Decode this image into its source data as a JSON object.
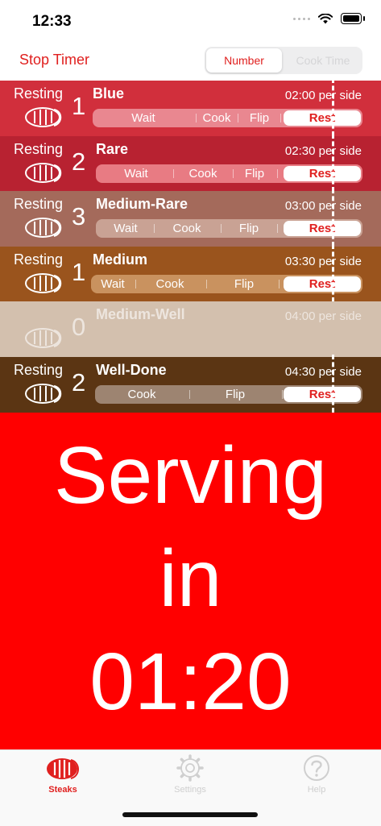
{
  "status_bar": {
    "time": "12:33"
  },
  "nav": {
    "stop_label": "Stop Timer",
    "segments": [
      "Number",
      "Cook Time"
    ],
    "selected_segment": "Number"
  },
  "colors": {
    "accent": "#e0201f",
    "serving_bg": "#ff0000",
    "rows": [
      "#d12f3c",
      "#b82231",
      "#a46a5b",
      "#9a541d",
      "#d3c0ae",
      "#5b3513"
    ]
  },
  "steaks": [
    {
      "status": "Resting",
      "count": "1",
      "name": "Blue",
      "per_side": "02:00 per side",
      "phases": [
        "Wait",
        "Cook",
        "Flip"
      ],
      "rest": "Rest"
    },
    {
      "status": "Resting",
      "count": "2",
      "name": "Rare",
      "per_side": "02:30 per side",
      "phases": [
        "Wait",
        "Cook",
        "Flip"
      ],
      "rest": "Rest"
    },
    {
      "status": "Resting",
      "count": "3",
      "name": "Medium-Rare",
      "per_side": "03:00 per side",
      "phases": [
        "Wait",
        "Cook",
        "Flip"
      ],
      "rest": "Rest"
    },
    {
      "status": "Resting",
      "count": "1",
      "name": "Medium",
      "per_side": "03:30 per side",
      "phases": [
        "Wait",
        "Cook",
        "Flip"
      ],
      "rest": "Rest"
    },
    {
      "status": "",
      "count": "0",
      "name": "Medium-Well",
      "per_side": "04:00 per side",
      "phases": [],
      "rest": ""
    },
    {
      "status": "Resting",
      "count": "2",
      "name": "Well-Done",
      "per_side": "04:30 per side",
      "phases": [
        "Cook",
        "Flip"
      ],
      "rest": "Rest"
    }
  ],
  "serving": {
    "line1": "Serving",
    "line2": "in",
    "countdown": "01:20"
  },
  "tabs": [
    {
      "label": "Steaks",
      "icon": "steak-icon",
      "active": true
    },
    {
      "label": "Settings",
      "icon": "gear-icon",
      "active": false
    },
    {
      "label": "Help",
      "icon": "question-mark-icon",
      "active": false
    }
  ]
}
